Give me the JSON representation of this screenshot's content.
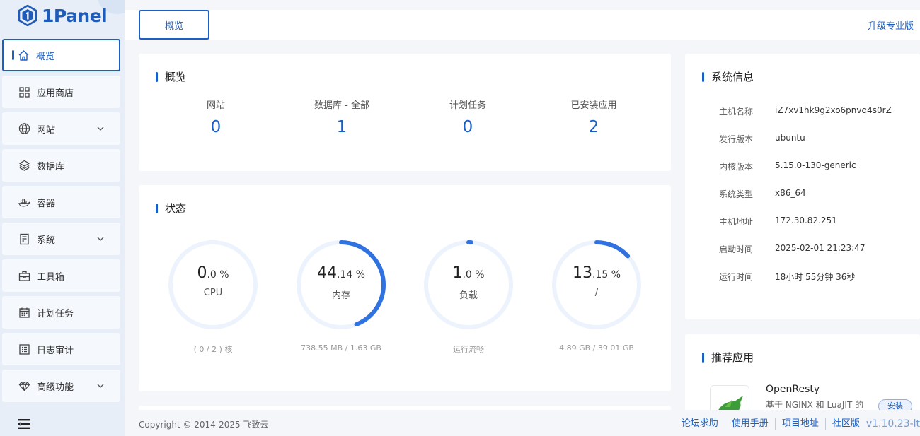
{
  "brand": {
    "name": "1Panel"
  },
  "sidebar": {
    "items": [
      {
        "label": "概览",
        "icon": "home-icon",
        "active": true
      },
      {
        "label": "应用商店",
        "icon": "grid-icon"
      },
      {
        "label": "网站",
        "icon": "globe-icon",
        "expandable": true
      },
      {
        "label": "数据库",
        "icon": "layers-icon"
      },
      {
        "label": "容器",
        "icon": "docker-icon"
      },
      {
        "label": "系统",
        "icon": "server-icon",
        "expandable": true
      },
      {
        "label": "工具箱",
        "icon": "toolbox-icon"
      },
      {
        "label": "计划任务",
        "icon": "calendar-icon"
      },
      {
        "label": "日志审计",
        "icon": "log-icon"
      },
      {
        "label": "高级功能",
        "icon": "diamond-icon",
        "expandable": true
      }
    ]
  },
  "topbar": {
    "tab_label": "概览",
    "upgrade_label": "升级专业版"
  },
  "overview": {
    "title": "概览",
    "stats": [
      {
        "label": "网站",
        "value": "0"
      },
      {
        "label": "数据库 - 全部",
        "value": "1"
      },
      {
        "label": "计划任务",
        "value": "0"
      },
      {
        "label": "已安装应用",
        "value": "2"
      }
    ]
  },
  "status": {
    "title": "状态",
    "gauges": [
      {
        "int": "0",
        "dec": ".0 %",
        "name": "CPU",
        "sub": "( 0 / 2 ) 核",
        "percent": 0.0
      },
      {
        "int": "44",
        "dec": ".14 %",
        "name": "内存",
        "sub": "738.55 MB / 1.63 GB",
        "percent": 44.14
      },
      {
        "int": "1",
        "dec": ".0 %",
        "name": "负载",
        "sub": "运行流畅",
        "percent": 1.0
      },
      {
        "int": "13",
        "dec": ".15 %",
        "name": "/",
        "sub": "4.89 GB / 39.01 GB",
        "percent": 13.15
      }
    ]
  },
  "sysinfo": {
    "title": "系统信息",
    "rows": [
      {
        "k": "主机名称",
        "v": "iZ7xv1hk9g2xo6pnvq4s0rZ"
      },
      {
        "k": "发行版本",
        "v": "ubuntu"
      },
      {
        "k": "内核版本",
        "v": "5.15.0-130-generic"
      },
      {
        "k": "系统类型",
        "v": "x86_64"
      },
      {
        "k": "主机地址",
        "v": "172.30.82.251"
      },
      {
        "k": "启动时间",
        "v": "2025-02-01 21:23:47"
      },
      {
        "k": "运行时间",
        "v": "18小时 55分钟 36秒"
      }
    ]
  },
  "recommend": {
    "title": "推荐应用",
    "app": {
      "name": "OpenResty",
      "desc": "基于 NGINX 和 LuaJIT 的",
      "install_label": "安装"
    }
  },
  "footer": {
    "copyright": "Copyright © 2014-2025 飞致云",
    "links": [
      "论坛求助",
      "使用手册",
      "项目地址",
      "社区版"
    ],
    "version": "v1.10.23-lt"
  },
  "colors": {
    "accent": "#1c5fc2",
    "gauge_track": "#edf3fc",
    "gauge_arc": "#2f72e0"
  }
}
